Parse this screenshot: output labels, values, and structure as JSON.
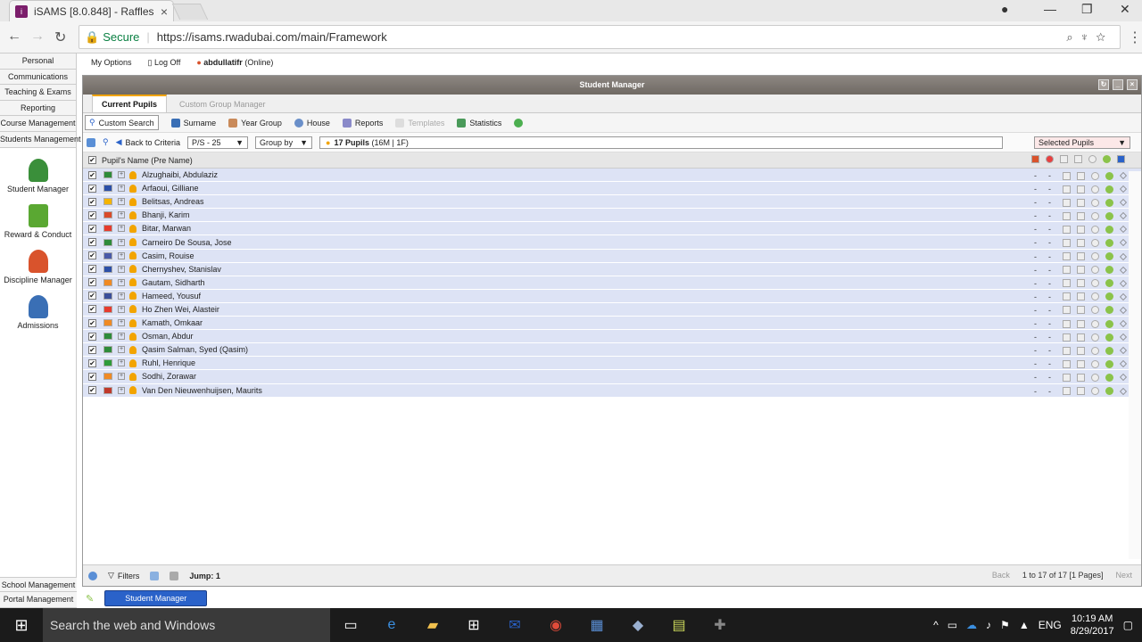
{
  "browser": {
    "tab_title": "iSAMS [8.0.848] - Raffles",
    "secure_label": "Secure",
    "url": "https://isams.rwadubai.com/main/Framework"
  },
  "sidebar": {
    "links": [
      "Personal",
      "Communications",
      "Teaching & Exams",
      "Reporting",
      "Course Management",
      "Students Management"
    ],
    "apps": [
      {
        "label": "Student Manager",
        "icon": "student-manager-icon",
        "color": "#3a8f3a"
      },
      {
        "label": "Reward & Conduct",
        "icon": "checkmark-icon",
        "color": "#5aa832"
      },
      {
        "label": "Discipline Manager",
        "icon": "discipline-icon",
        "color": "#d9532c"
      },
      {
        "label": "Admissions",
        "icon": "admissions-icon",
        "color": "#3a6fb5"
      }
    ],
    "bottom_links": [
      "School Management",
      "Portal Management"
    ]
  },
  "topmenu": {
    "options": "My Options",
    "logoff": "Log Off",
    "user": "abdullatifr",
    "status": "(Online)"
  },
  "panel": {
    "title": "Student Manager",
    "tabs": [
      "Current Pupils",
      "Custom Group Manager"
    ],
    "toolbar": [
      "Custom Search",
      "Surname",
      "Year Group",
      "House",
      "Reports",
      "Templates",
      "Statistics"
    ],
    "back_to_criteria": "Back to Criteria",
    "year_select": "P/S - 25",
    "group_by": "Group by",
    "pupil_count": "17 Pupils",
    "pupil_breakdown": "(16M | 1F)",
    "selected_pupils": "Selected Pupils",
    "column_header": "Pupil's Name (Pre Name)",
    "pupils": [
      {
        "name": "Alzughaibi, Abdulaziz",
        "flag": "#2e8b3a"
      },
      {
        "name": "Arfaoui, Gilliane",
        "flag": "#2b4fa8"
      },
      {
        "name": "Belitsas, Andreas",
        "flag": "#f5b400"
      },
      {
        "name": "Bhanji, Karim",
        "flag": "#d94a2a"
      },
      {
        "name": "Bitar, Marwan",
        "flag": "#e63b2e"
      },
      {
        "name": "Carneiro De Sousa, Jose",
        "flag": "#2e8b3a"
      },
      {
        "name": "Casim, Rouise",
        "flag": "#4a5aa8"
      },
      {
        "name": "Chernyshev, Stanislav",
        "flag": "#2b4fa8"
      },
      {
        "name": "Gautam, Sidharth",
        "flag": "#f08a24"
      },
      {
        "name": "Hameed, Yousuf",
        "flag": "#3b4f9a"
      },
      {
        "name": "Ho Zhen Wei, Alasteir",
        "flag": "#e63b2e"
      },
      {
        "name": "Kamath, Omkaar",
        "flag": "#f08a24"
      },
      {
        "name": "Osman, Abdur",
        "flag": "#2e8b3a"
      },
      {
        "name": "Qasim Salman, Syed (Qasim)",
        "flag": "#2e8b3a"
      },
      {
        "name": "Ruhl, Henrique",
        "flag": "#2e9b3a"
      },
      {
        "name": "Sodhi, Zorawar",
        "flag": "#f08a24"
      },
      {
        "name": "Van Den Nieuwenhuijsen, Maurits",
        "flag": "#c0392b"
      }
    ],
    "footer": {
      "filters": "Filters",
      "jump": "Jump: 1",
      "back": "Back",
      "pages": "1 to 17 of 17 [1 Pages]",
      "next": "Next"
    }
  },
  "appbar": {
    "button": "Student Manager"
  },
  "taskbar": {
    "search_placeholder": "Search the web and Windows",
    "lang": "ENG",
    "time": "10:19 AM",
    "date": "8/29/2017"
  }
}
